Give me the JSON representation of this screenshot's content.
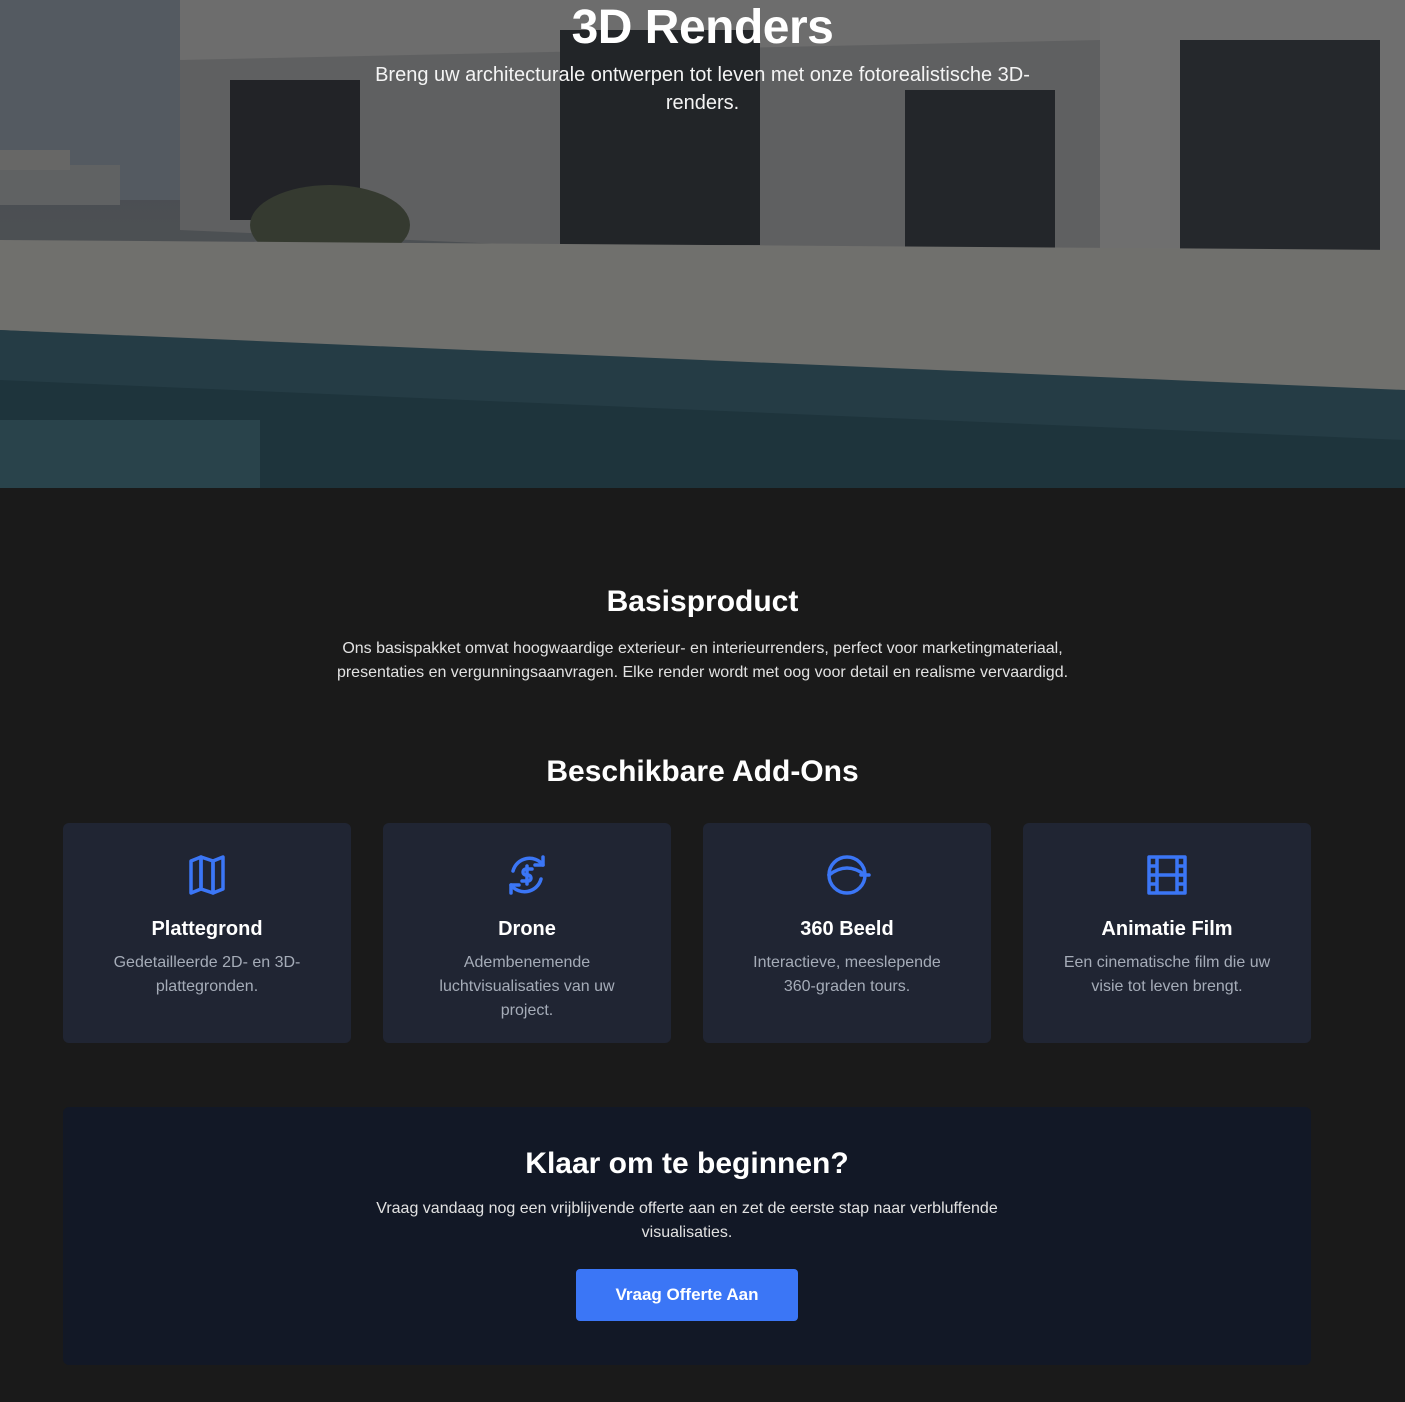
{
  "hero": {
    "title": "3D Renders",
    "subtitle": "Breng uw architecturale ontwerpen tot leven met onze fotorealistische 3D-renders."
  },
  "basis": {
    "title": "Basisproduct",
    "text": "Ons basispakket omvat hoogwaardige exterieur- en interieurrenders, perfect voor marketingmateriaal, presentaties en vergunningsaanvragen. Elke render wordt met oog voor detail en realisme vervaardigd."
  },
  "addons": {
    "title": "Beschikbare Add-Ons",
    "items": [
      {
        "icon": "map-icon",
        "title": "Plattegrond",
        "text": "Gedetailleerde 2D- en 3D-plattegronden."
      },
      {
        "icon": "drone-currency-refresh-icon",
        "title": "Drone",
        "text": "Adembenemende luchtvisualisaties van uw project."
      },
      {
        "icon": "360-view-icon",
        "title": "360 Beeld",
        "text": "Interactieve, meeslepende 360-graden tours."
      },
      {
        "icon": "film-icon",
        "title": "Animatie Film",
        "text": "Een cinematische film die uw visie tot leven brengt."
      }
    ]
  },
  "cta": {
    "title": "Klaar om te beginnen?",
    "text": "Vraag vandaag nog een vrijblijvende offerte aan en zet de eerste stap naar verbluffende visualisaties.",
    "button_label": "Vraag Offerte Aan"
  },
  "colors": {
    "page_background": "#1a1a1a",
    "card_background": "#202533",
    "cta_background": "#121826",
    "accent": "#3b76f6",
    "muted_text": "#a5acb8"
  }
}
